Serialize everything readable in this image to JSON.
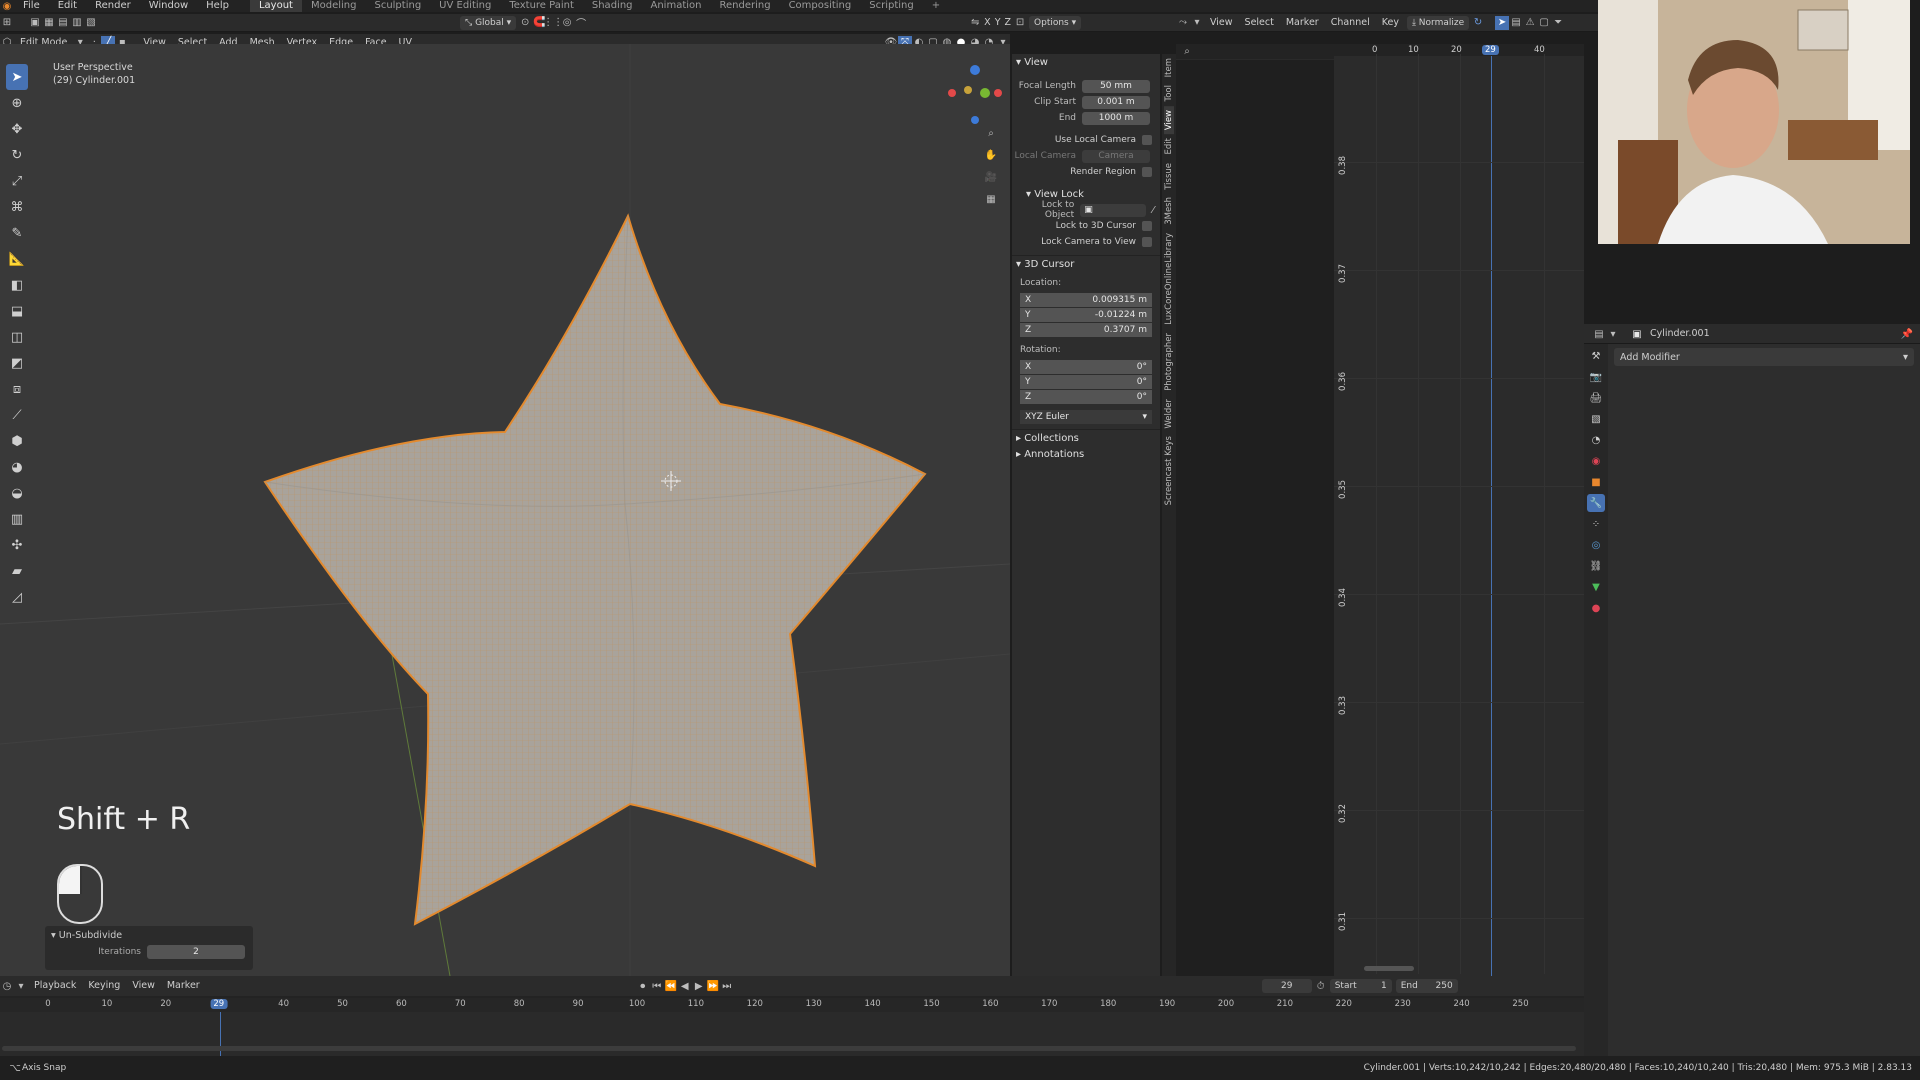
{
  "top_menu": {
    "items": [
      "File",
      "Edit",
      "Render",
      "Window",
      "Help"
    ],
    "workspaces": [
      "Layout",
      "Modeling",
      "Sculpting",
      "UV Editing",
      "Texture Paint",
      "Shading",
      "Animation",
      "Rendering",
      "Compositing",
      "Scripting"
    ],
    "active_workspace": "Layout",
    "add_tab": "+"
  },
  "header": {
    "transform_orientation": "Global",
    "axes": [
      "X",
      "Y",
      "Z"
    ],
    "options_label": "Options"
  },
  "edit_header": {
    "mode": "Edit Mode",
    "menus": [
      "View",
      "Select",
      "Add",
      "Mesh",
      "Vertex",
      "Edge",
      "Face",
      "UV"
    ]
  },
  "viewport": {
    "perspective_label": "User Perspective",
    "object_label": "(29) Cylinder.001",
    "shortcut_text": "Shift + R",
    "redo_panel": {
      "title": "Un-Subdivide",
      "iterations_label": "Iterations",
      "iterations_value": "2"
    }
  },
  "npanel": {
    "view_section": "View",
    "focal_length_label": "Focal Length",
    "focal_length": "50 mm",
    "clip_start_label": "Clip Start",
    "clip_start": "0.001 m",
    "end_label": "End",
    "clip_end": "1000 m",
    "use_local_camera": "Use Local Camera",
    "local_camera_label": "Local Camera",
    "local_camera_value": "Camera",
    "render_region": "Render Region",
    "view_lock_section": "View Lock",
    "lock_to_object": "Lock to Object",
    "lock_to_cursor": "Lock to 3D Cursor",
    "lock_camera_to_view": "Lock Camera to View",
    "cursor_section": "3D Cursor",
    "location_label": "Location:",
    "loc_x": "0.009315 m",
    "loc_y": "-0.01224 m",
    "loc_z": "0.3707 m",
    "rotation_label": "Rotation:",
    "rot_x": "0°",
    "rot_y": "0°",
    "rot_z": "0°",
    "rotation_mode": "XYZ Euler",
    "collections": "Collections",
    "annotations": "Annotations",
    "axis_x": "X",
    "axis_y": "Y",
    "axis_z": "Z",
    "side_tabs": [
      "Item",
      "Tool",
      "View",
      "Edit",
      "Tissue",
      "3Mesh",
      "LuxCoreOnlineLibrary",
      "Photographer",
      "Welder",
      "Screencast Keys"
    ]
  },
  "graph_editor": {
    "menus": [
      "View",
      "Select",
      "Marker",
      "Channel",
      "Key"
    ],
    "normalize_label": "Normalize",
    "frame_ticks": [
      "0",
      "10",
      "20",
      "29",
      "40"
    ],
    "current_frame_badge": "29",
    "y_ticks": [
      "0.38",
      "0.37",
      "0.36",
      "0.35",
      "0.34",
      "0.33",
      "0.32",
      "0.31"
    ]
  },
  "properties": {
    "object_name": "Cylinder.001",
    "add_modifier": "Add Modifier"
  },
  "timeline": {
    "menus": [
      "Playback",
      "Keying",
      "View",
      "Marker"
    ],
    "current_frame": "29",
    "start_label": "Start",
    "start": "1",
    "end_label": "End",
    "end": "250",
    "ticks": [
      "0",
      "10",
      "20",
      "29",
      "40",
      "50",
      "60",
      "70",
      "80",
      "90",
      "100",
      "110",
      "120",
      "130",
      "140",
      "150",
      "160",
      "170",
      "180",
      "190",
      "200",
      "210",
      "220",
      "230",
      "240",
      "250"
    ]
  },
  "status_bar": {
    "left_text": "Axis Snap",
    "right_text": "Cylinder.001 | Verts:10,242/10,242 | Edges:20,480/20,480 | Faces:10,240/10,240 | Tris:20,480 | Mem: 975.3 MiB | 2.83.13"
  },
  "colors": {
    "accent": "#4772b3",
    "mesh_wire": "#e38a2e",
    "playhead": "#4772b3"
  }
}
